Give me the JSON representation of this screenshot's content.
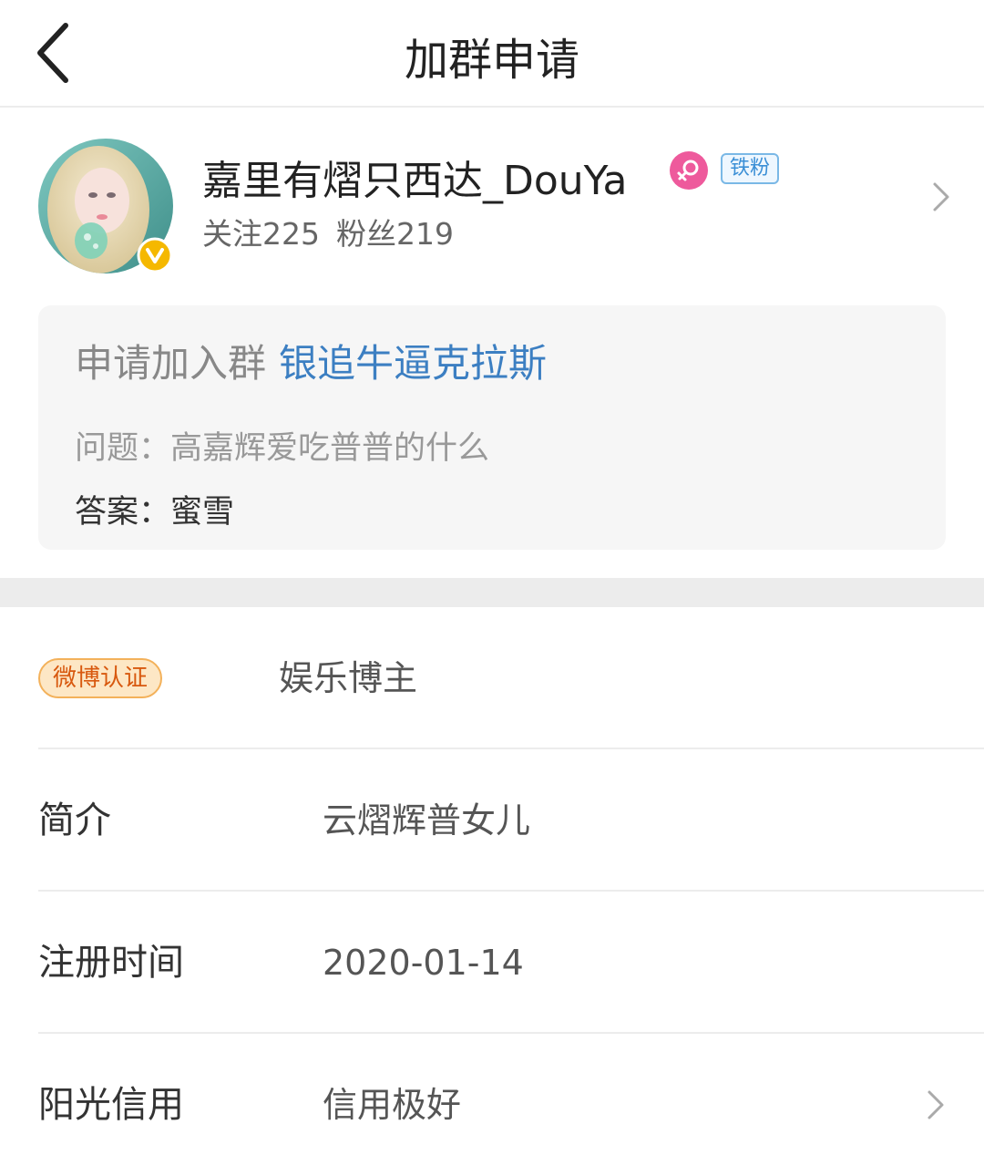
{
  "header": {
    "title": "加群申请"
  },
  "profile": {
    "username": "嘉里有熠只西达_DouYa",
    "fan_badge": "铁粉",
    "following_label": "关注225",
    "followers_label": "粉丝219",
    "gender_icon": "female-icon",
    "verify_icon": "verified-v-icon"
  },
  "application": {
    "prefix": "申请加入群",
    "group_name": "银追牛逼克拉斯",
    "question": "问题：高嘉辉爱吃普普的什么",
    "answer": "答案：蜜雪"
  },
  "info": {
    "verify_badge": "微博认证",
    "verify_value": "娱乐博主",
    "rows": [
      {
        "label": "简介",
        "value": "云熠辉普女儿"
      },
      {
        "label": "注册时间",
        "value": "2020-01-14"
      },
      {
        "label": "阳光信用",
        "value": "信用极好"
      }
    ]
  },
  "colors": {
    "link": "#3c7fc2",
    "verify_badge_text": "#d8590f",
    "verify_badge_bg": "#fde7c5",
    "fan_badge": "#3b8fd6",
    "gender_pink": "#ee5a9c",
    "v_badge": "#f5b800"
  }
}
